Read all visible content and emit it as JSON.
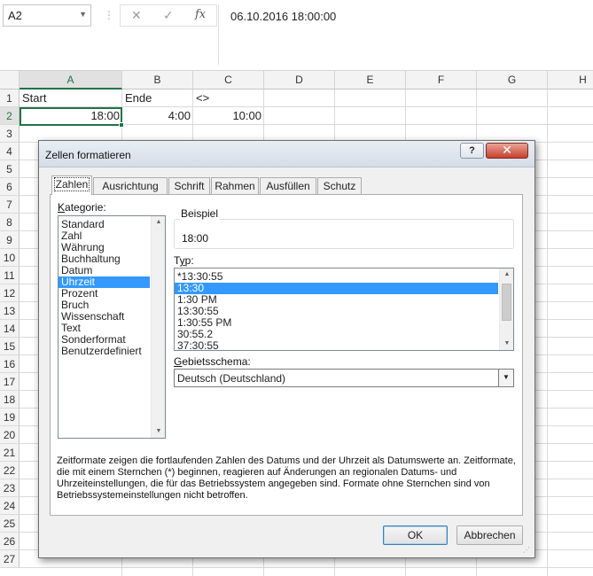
{
  "formula_bar": {
    "name_box": "A2",
    "cancel_icon": "✕",
    "enter_icon": "✓",
    "function_icon": "fx",
    "content": "06.10.2016  18:00:00"
  },
  "sheet": {
    "columns": [
      "A",
      "B",
      "C",
      "D",
      "E",
      "F",
      "G",
      "H"
    ],
    "rows": [
      "1",
      "2",
      "3",
      "4",
      "5",
      "6",
      "7",
      "8",
      "9",
      "10",
      "11",
      "12",
      "13",
      "14",
      "15",
      "16",
      "17",
      "18",
      "19",
      "20",
      "21",
      "22",
      "23",
      "24",
      "25",
      "26",
      "27"
    ],
    "cells": {
      "A1": "Start",
      "B1": "Ende",
      "C1": "<>",
      "A2": "18:00",
      "B2": "4:00",
      "C2": "10:00"
    },
    "selected_cell": "A2",
    "accent": "#217346"
  },
  "dialog": {
    "title": "Zellen formatieren",
    "help_label": "?",
    "close_label": "✕",
    "tabs": [
      {
        "label": "Zahlen",
        "active": true
      },
      {
        "label": "Ausrichtung",
        "active": false
      },
      {
        "label": "Schrift",
        "active": false
      },
      {
        "label": "Rahmen",
        "active": false
      },
      {
        "label": "Ausfüllen",
        "active": false
      },
      {
        "label": "Schutz",
        "active": false
      }
    ],
    "category_label": "Kategorie:",
    "categories": [
      "Standard",
      "Zahl",
      "Währung",
      "Buchhaltung",
      "Datum",
      "Uhrzeit",
      "Prozent",
      "Bruch",
      "Wissenschaft",
      "Text",
      "Sonderformat",
      "Benutzerdefiniert"
    ],
    "selected_category": "Uhrzeit",
    "sample_label": "Beispiel",
    "sample_value": "18:00",
    "type_label": "Typ:",
    "types": [
      "*13:30:55",
      "13:30",
      "1:30 PM",
      "13:30:55",
      "1:30:55 PM",
      "30:55.2",
      "37:30:55"
    ],
    "selected_type": "13:30",
    "locale_label": "Gebietsschema:",
    "locale_value": "Deutsch (Deutschland)",
    "description": "Zeitformate zeigen die fortlaufenden Zahlen des Datums und der Uhrzeit als Datumswerte an. Zeitformate, die mit einem Sternchen (*) beginnen, reagieren auf Änderungen an regionalen Datums- und Uhrzeiteinstellungen, die für das Betriebssystem angegeben sind. Formate ohne Sternchen sind von Betriebssystemeinstellungen nicht betroffen.",
    "ok_label": "OK",
    "cancel_label": "Abbrechen",
    "selection_color": "#3399ff"
  }
}
